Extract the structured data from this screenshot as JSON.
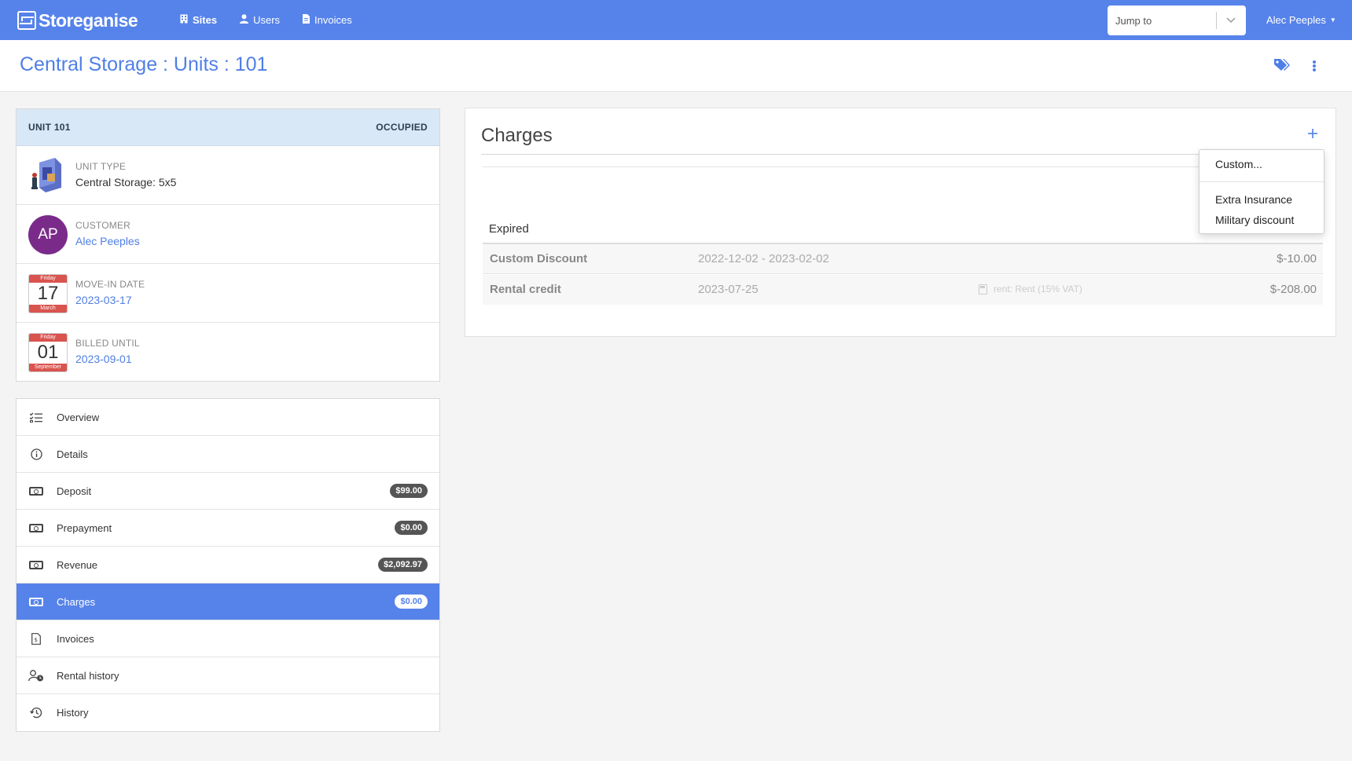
{
  "navbar": {
    "brand": "Storeganise",
    "links": [
      {
        "label": "Sites",
        "icon": "building-icon",
        "active": true
      },
      {
        "label": "Users",
        "icon": "user-icon",
        "active": false
      },
      {
        "label": "Invoices",
        "icon": "document-icon",
        "active": false
      }
    ],
    "jump_placeholder": "Jump to",
    "user_name": "Alec Peeples",
    "color": "#5683ea"
  },
  "page": {
    "title": "Central Storage : Units : 101"
  },
  "unit": {
    "header_label": "UNIT 101",
    "status": "OCCUPIED",
    "unit_type_label": "UNIT TYPE",
    "unit_type_value": "Central Storage: 5x5",
    "customer_label": "CUSTOMER",
    "customer_initials": "AP",
    "customer_name": "Alec Peeples",
    "movein_label": "MOVE-IN DATE",
    "movein_weekday": "Friday",
    "movein_day": "17",
    "movein_month": "March",
    "movein_date": "2023-03-17",
    "billed_label": "BILLED UNTIL",
    "billed_weekday": "Friday",
    "billed_day": "01",
    "billed_month": "September",
    "billed_date": "2023-09-01"
  },
  "side_nav": [
    {
      "label": "Overview",
      "icon": "checklist-icon",
      "badge": null,
      "active": false
    },
    {
      "label": "Details",
      "icon": "info-icon",
      "badge": null,
      "active": false
    },
    {
      "label": "Deposit",
      "icon": "money-icon",
      "badge": "$99.00",
      "active": false
    },
    {
      "label": "Prepayment",
      "icon": "money-icon",
      "badge": "$0.00",
      "active": false
    },
    {
      "label": "Revenue",
      "icon": "money-icon",
      "badge": "$2,092.97",
      "active": false
    },
    {
      "label": "Charges",
      "icon": "money-icon",
      "badge": "$0.00",
      "active": true
    },
    {
      "label": "Invoices",
      "icon": "invoice-icon",
      "badge": null,
      "active": false
    },
    {
      "label": "Rental history",
      "icon": "user-clock-icon",
      "badge": null,
      "active": false
    },
    {
      "label": "History",
      "icon": "history-icon",
      "badge": null,
      "active": false
    }
  ],
  "charges": {
    "title": "Charges",
    "expired_label": "Expired",
    "rows": [
      {
        "name": "Custom Discount",
        "dates": "2022-12-02 - 2023-02-02",
        "note": "",
        "amount": "$-10.00"
      },
      {
        "name": "Rental credit",
        "dates": "2023-07-25",
        "note": "rent: Rent (15% VAT)",
        "amount": "$-208.00"
      }
    ]
  },
  "add_menu": {
    "items": [
      "Custom...",
      "Extra Insurance",
      "Military discount"
    ]
  }
}
